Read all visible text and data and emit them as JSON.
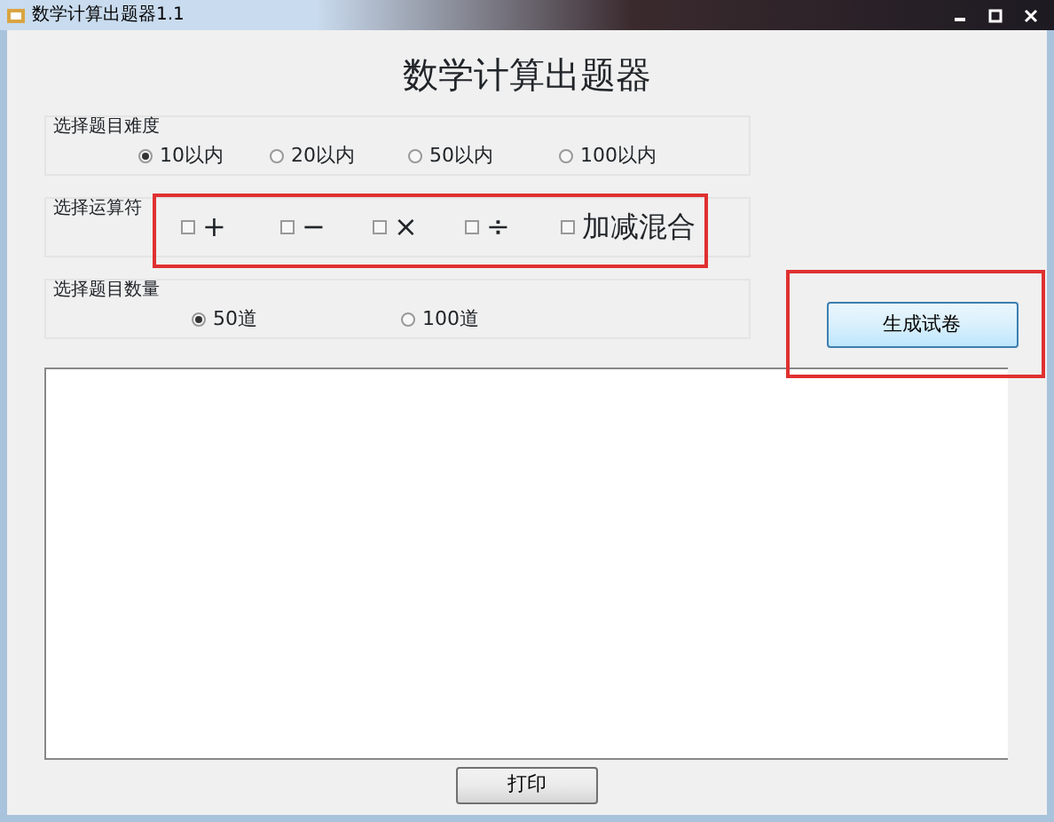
{
  "window": {
    "title": "数学计算出题器1.1"
  },
  "heading": "数学计算出题器",
  "difficulty": {
    "label": "选择题目难度",
    "options": [
      {
        "label": "10以内",
        "selected": true
      },
      {
        "label": "20以内",
        "selected": false
      },
      {
        "label": "50以内",
        "selected": false
      },
      {
        "label": "100以内",
        "selected": false
      }
    ]
  },
  "operators": {
    "label": "选择运算符",
    "options": [
      {
        "label": "+",
        "checked": false
      },
      {
        "label": "−",
        "checked": false
      },
      {
        "label": "×",
        "checked": false
      },
      {
        "label": "÷",
        "checked": false
      },
      {
        "label": "加减混合",
        "checked": false
      }
    ]
  },
  "count": {
    "label": "选择题目数量",
    "options": [
      {
        "label": "50道",
        "selected": true
      },
      {
        "label": "100道",
        "selected": false
      }
    ]
  },
  "generate_button": "生成试卷",
  "print_button": "打印"
}
